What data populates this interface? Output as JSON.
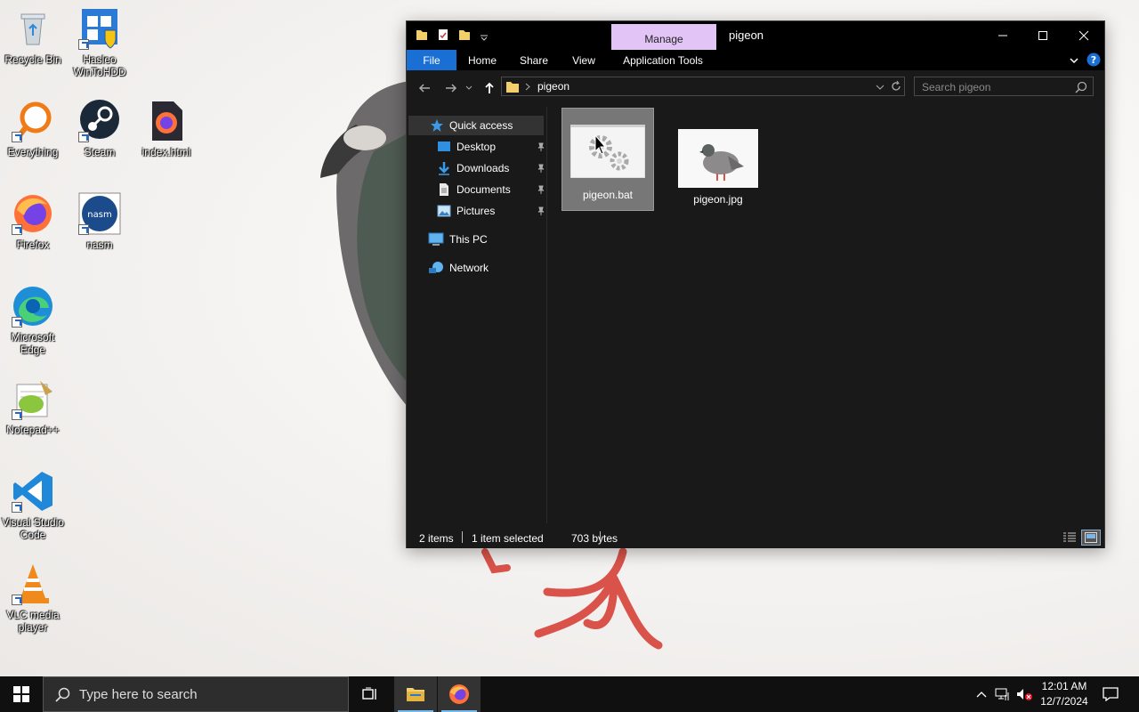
{
  "desktop": {
    "icons": [
      {
        "label": "Recycle Bin"
      },
      {
        "label": "Hasleo WinToHDD"
      },
      {
        "label": "Everything"
      },
      {
        "label": "Steam"
      },
      {
        "label": "index.html"
      },
      {
        "label": "Firefox"
      },
      {
        "label": "nasm"
      },
      {
        "label": "Microsoft Edge"
      },
      {
        "label": "Notepad++"
      },
      {
        "label": "Visual Studio Code"
      },
      {
        "label": "VLC media player"
      }
    ]
  },
  "explorer": {
    "title": "pigeon",
    "context_tab": "Manage",
    "ribbon_tabs": [
      "File",
      "Home",
      "Share",
      "View",
      "Application Tools"
    ],
    "address": {
      "current": "pigeon"
    },
    "search": {
      "placeholder": "Search pigeon"
    },
    "nav": {
      "quick_access": "Quick access",
      "items": [
        "Desktop",
        "Downloads",
        "Documents",
        "Pictures"
      ],
      "this_pc": "This PC",
      "network": "Network"
    },
    "files": [
      {
        "name": "pigeon.bat",
        "selected": true
      },
      {
        "name": "pigeon.jpg",
        "selected": false
      }
    ],
    "status": {
      "items": "2 items",
      "selected": "1 item selected",
      "size": "703 bytes"
    }
  },
  "taskbar": {
    "search_placeholder": "Type here to search",
    "time": "12:01 AM",
    "date": "12/7/2024"
  },
  "colors": {
    "accent": "#1a6fd4",
    "manage_tab": "#e2c4f7",
    "window_bg": "#191919"
  }
}
